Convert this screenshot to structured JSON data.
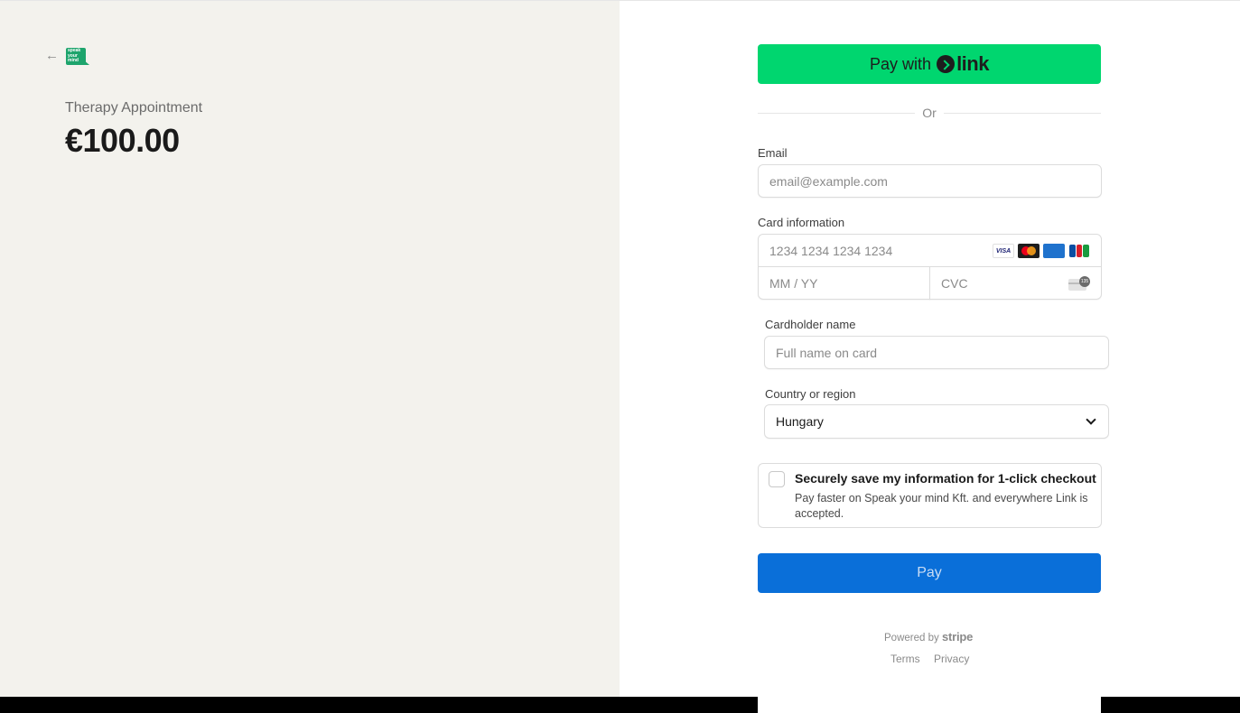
{
  "merchant": {
    "logo_text": [
      "speak",
      "your",
      "mind"
    ]
  },
  "summary": {
    "product_name": "Therapy Appointment",
    "price": "€100.00"
  },
  "express": {
    "pay_with": "Pay with",
    "link_word": "link",
    "divider": "Or"
  },
  "form": {
    "email": {
      "label": "Email",
      "placeholder": "email@example.com"
    },
    "card": {
      "label": "Card information",
      "number_placeholder": "1234 1234 1234 1234",
      "expiry_placeholder": "MM / YY",
      "cvc_placeholder": "CVC",
      "brands": [
        "VISA",
        "mastercard",
        "AMEX",
        "JCB"
      ],
      "cvc_badge": "135"
    },
    "cardholder": {
      "label": "Cardholder name",
      "placeholder": "Full name on card"
    },
    "country": {
      "label": "Country or region",
      "value": "Hungary"
    }
  },
  "save_info": {
    "title": "Securely save my information for 1-click checkout",
    "description": "Pay faster on Speak your mind Kft. and everywhere Link is accepted."
  },
  "pay_button": {
    "label": "Pay"
  },
  "footer": {
    "powered_by": "Powered by",
    "stripe": "stripe",
    "terms": "Terms",
    "privacy": "Privacy"
  },
  "colors": {
    "link_green": "#00d66f",
    "pay_blue": "#0a6fd9",
    "left_bg": "#f3f2ed",
    "logo_green": "#1da46c"
  }
}
